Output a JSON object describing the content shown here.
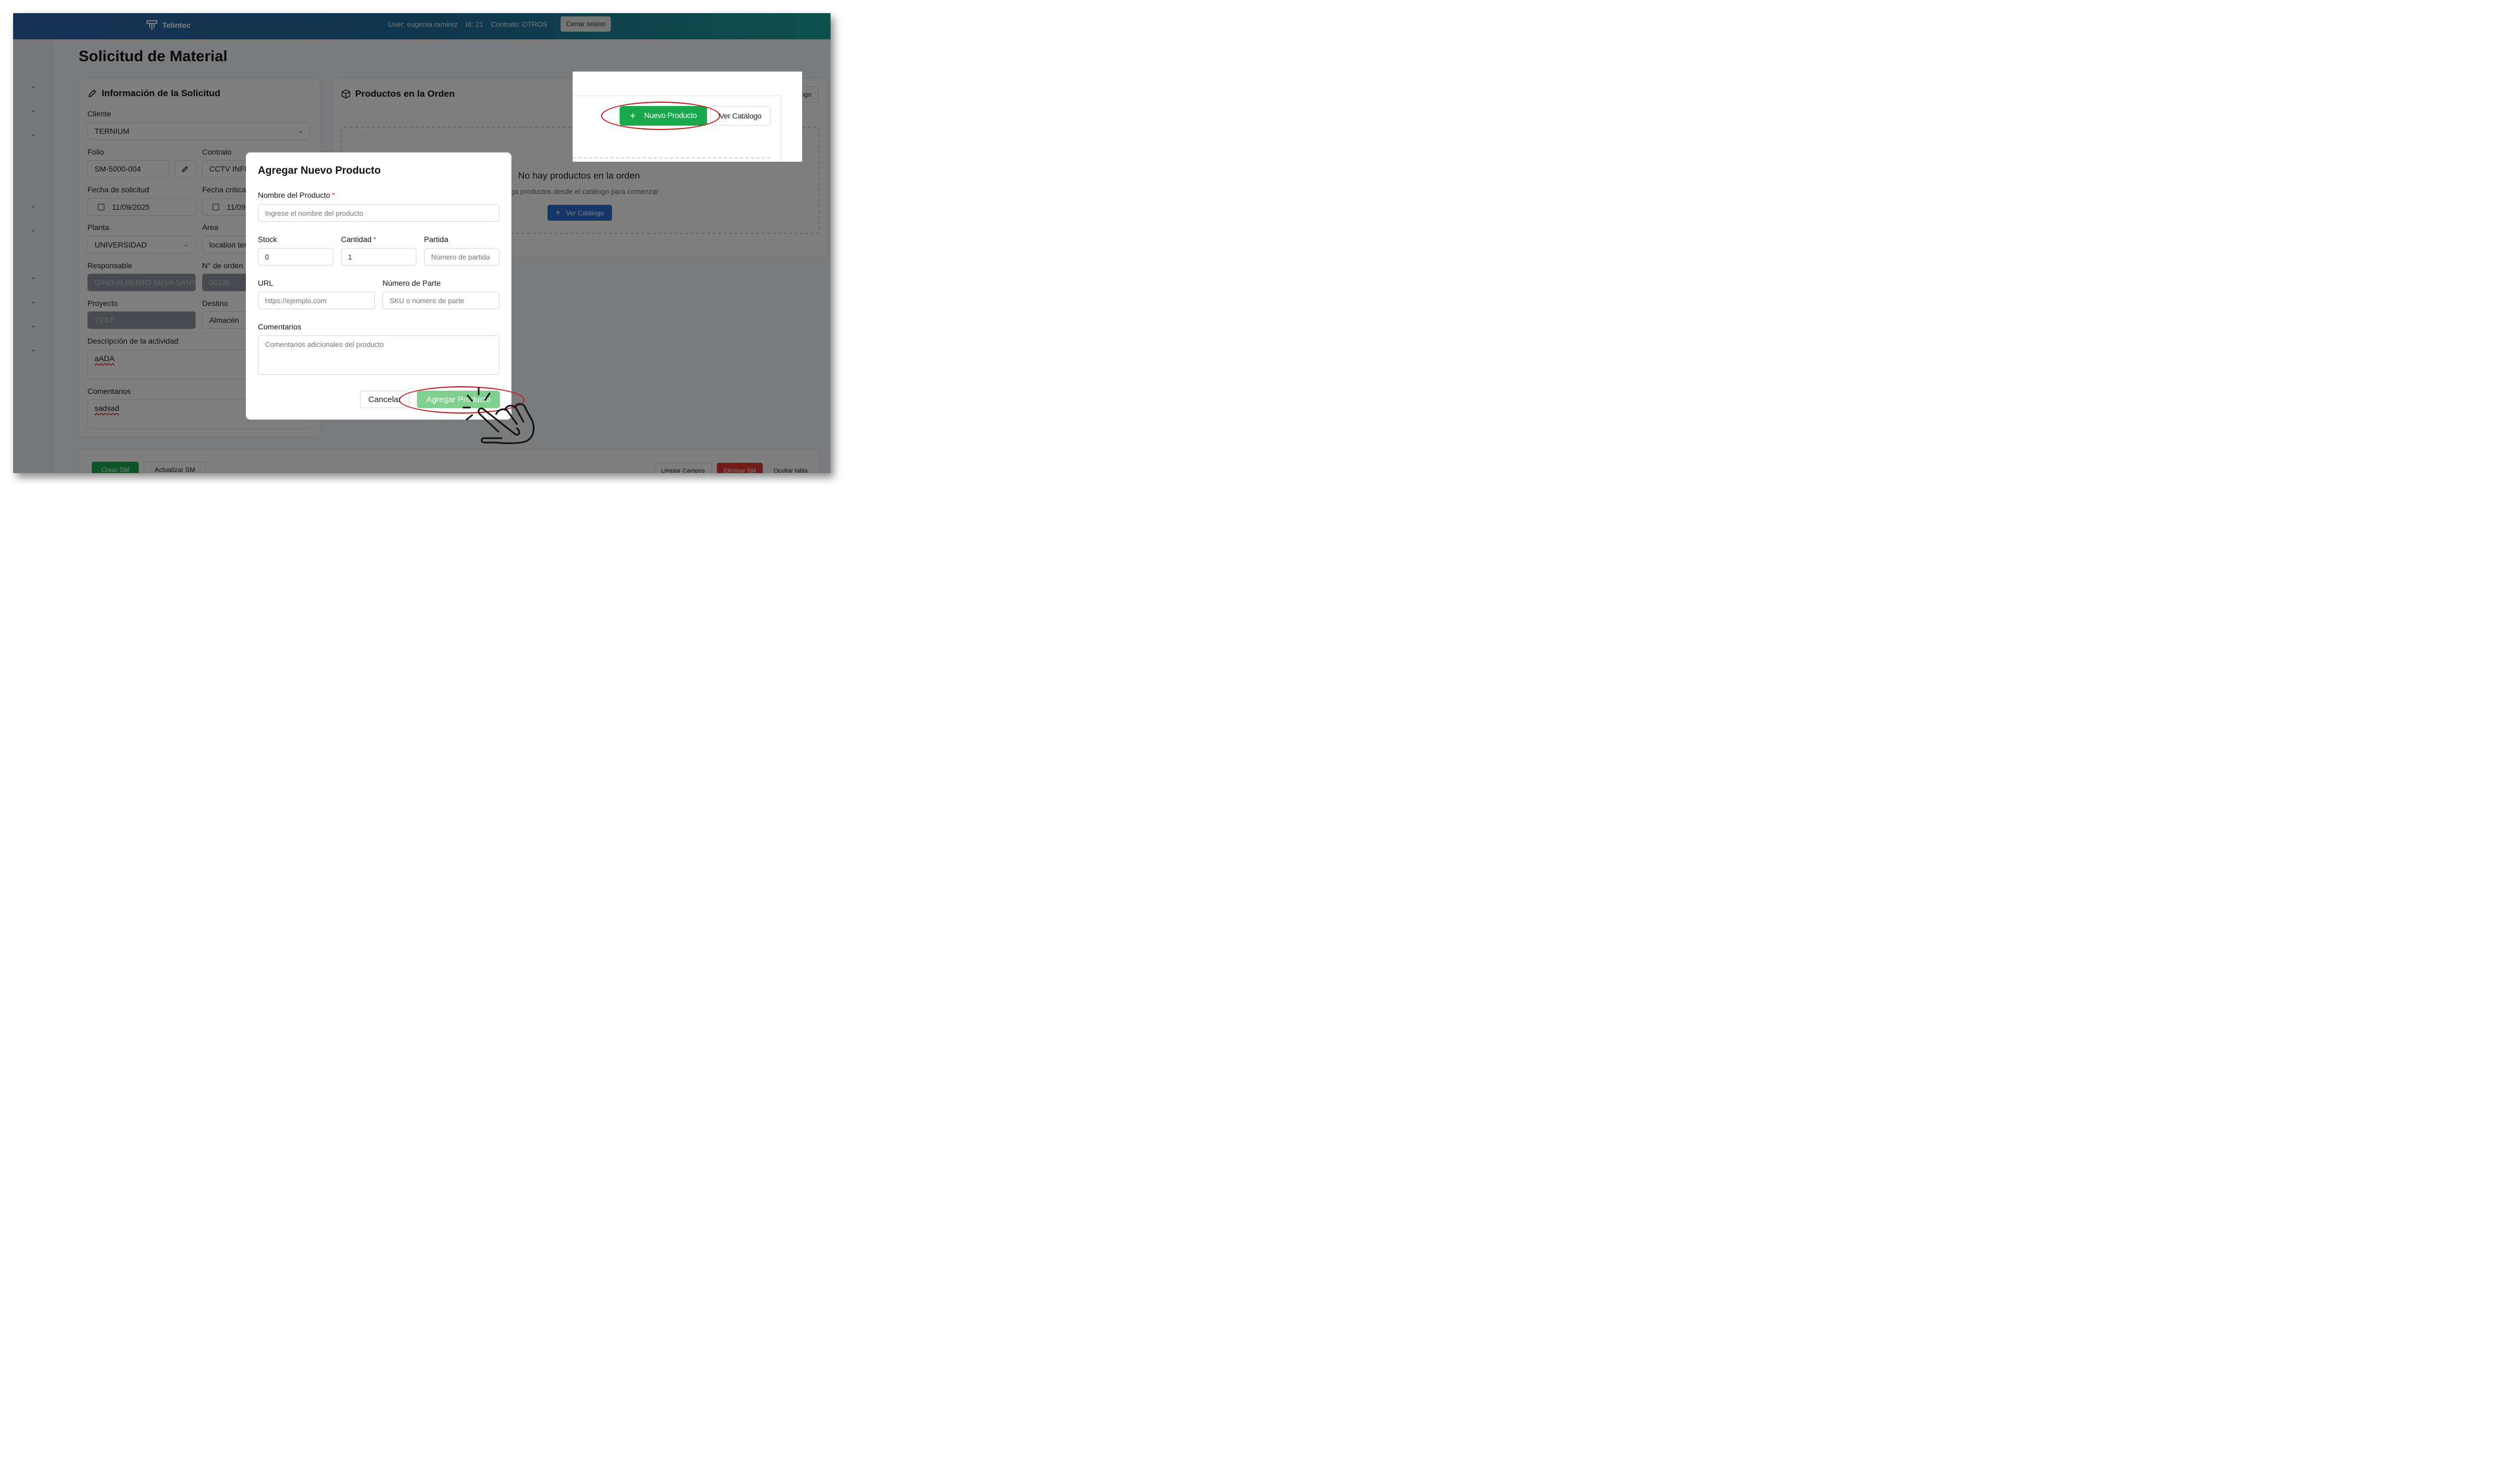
{
  "header": {
    "brand": "Telintec",
    "user": "User: eugenia.ramirez",
    "id": "Id: 21",
    "contract": "Contrato: OTROS",
    "logout_label": "Cerrar sesion"
  },
  "page": {
    "title": "Solicitud de Material"
  },
  "info_card": {
    "title": "Información de la Solicitud",
    "cliente_label": "Cliente",
    "cliente_value": "TERNIUM",
    "folio_label": "Folio",
    "folio_value": "SM-5000-004",
    "contrato_label": "Contrato",
    "contrato_value": "CCTV INFR",
    "fecha_solicitud_label": "Fecha de solicitud",
    "fecha_solicitud_value": "11/09/2025",
    "fecha_critica_label": "Fecha crítica",
    "fecha_critica_value": "11/09",
    "planta_label": "Planta",
    "planta_value": "UNIVERSIDAD",
    "area_label": "Área",
    "area_value": "location ten",
    "responsable_label": "Responsable",
    "responsable_value": "GINO ALBERTO SILVA SANT",
    "orden_label": "N° de orden",
    "orden_value": "00136",
    "proyecto_label": "Proyecto",
    "proyecto_value": "TEST",
    "destino_label": "Destino",
    "destino_value": "Almacén",
    "descripcion_label": "Descripción de la actividad",
    "descripcion_value": "aADA",
    "comentarios_label": "Comentarios",
    "comentarios_value": "sadsad"
  },
  "products_card": {
    "title": "Productos en la Orden",
    "catalog_partial": "ogo",
    "empty_title": "No hay productos en la orden",
    "empty_subtitle": "ga productos desde el catálogo para comenzar",
    "catalog_button": "Ver Catálogo"
  },
  "bottom_bar": {
    "crear": "Crear SM",
    "actualizar": "Actualizar SM",
    "limpiar": "Limpiar Campos",
    "eliminar": "Eliminar SM",
    "ocultar": "Ocultar tabla"
  },
  "modal": {
    "title": "Agregar Nuevo Producto",
    "nombre_label": "Nombre del Producto",
    "nombre_placeholder": "Ingrese el nombre del producto",
    "stock_label": "Stock",
    "stock_value": "0",
    "cantidad_label": "Cantidad",
    "cantidad_value": "1",
    "partida_label": "Partida",
    "partida_placeholder": "Número de partida",
    "url_label": "URL",
    "url_placeholder": "https://ejemplo.com",
    "parte_label": "Número de Parte",
    "parte_placeholder": "SKU o número de parte",
    "comentarios_label": "Comentarios",
    "comentarios_placeholder": "Comentarios adicionales del producto",
    "required_mark": "*",
    "cancel_label": "Cancelar",
    "add_label": "Agregar Producto"
  },
  "inset": {
    "new_product_label": "Nuevo Producto",
    "catalog_label": "Ver Catálogo"
  },
  "colors": {
    "header_start": "#2b62a8",
    "header_end": "#1aa39a",
    "green": "#1aa84c",
    "green_light": "#7fcf8e",
    "blue": "#2d6cd0",
    "red": "#c21818"
  }
}
